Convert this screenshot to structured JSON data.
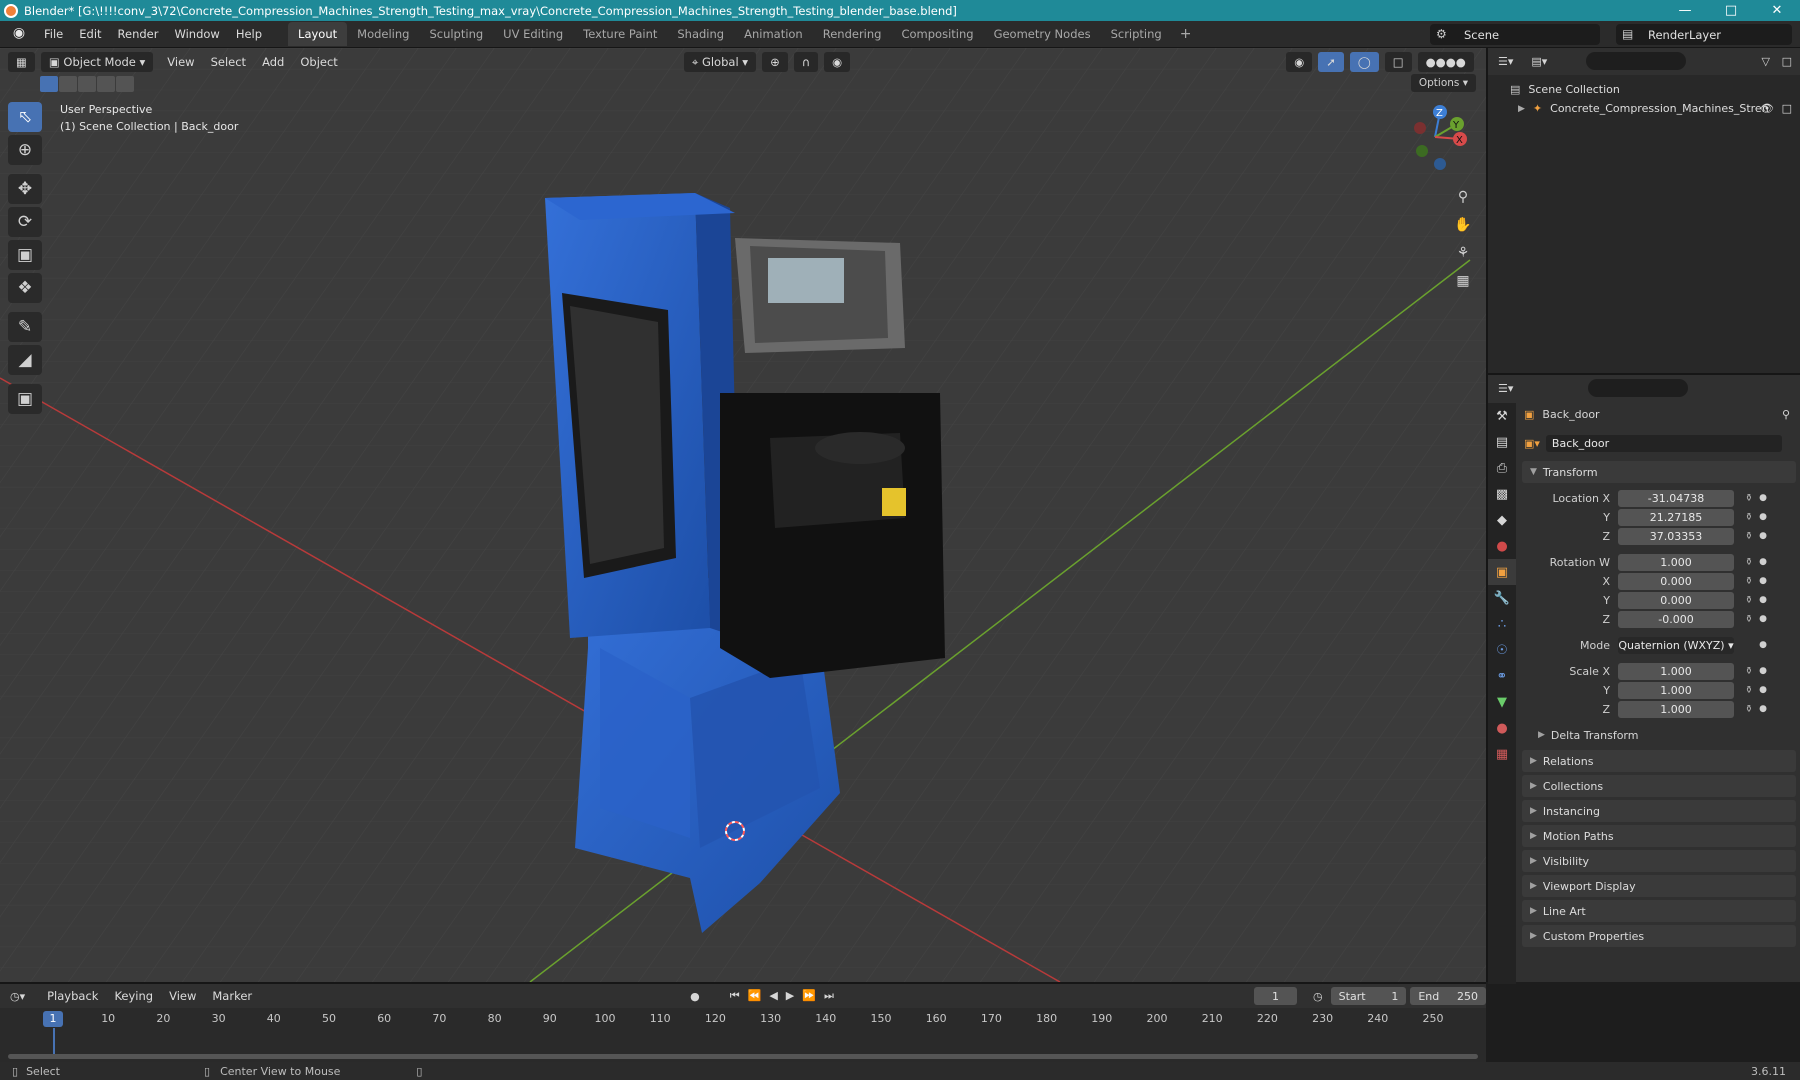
{
  "window": {
    "title": "Blender* [G:\\!!!!conv_3\\72\\Concrete_Compression_Machines_Strength_Testing_max_vray\\Concrete_Compression_Machines_Strength_Testing_blender_base.blend]"
  },
  "menu": [
    "File",
    "Edit",
    "Render",
    "Window",
    "Help"
  ],
  "workspaces": [
    "Layout",
    "Modeling",
    "Sculpting",
    "UV Editing",
    "Texture Paint",
    "Shading",
    "Animation",
    "Rendering",
    "Compositing",
    "Geometry Nodes",
    "Scripting"
  ],
  "active_workspace": "Layout",
  "scene": {
    "name": "Scene",
    "render_layer": "RenderLayer"
  },
  "viewport": {
    "mode": "Object Mode",
    "menus": [
      "View",
      "Select",
      "Add",
      "Object"
    ],
    "orientation": "Global",
    "options": "Options",
    "perspective_label": "User Perspective",
    "collection_label": "(1) Scene Collection | Back_door",
    "gizmo_axes": {
      "x": "X",
      "y": "Y",
      "z": "Z"
    }
  },
  "outliner": {
    "root": "Scene Collection",
    "items": [
      {
        "label": "Concrete_Compression_Machines_Stren"
      }
    ]
  },
  "properties": {
    "object_name": "Back_door",
    "datablock_name": "Back_door",
    "transform_title": "Transform",
    "location": {
      "label": "Location X",
      "x": "-31.04738",
      "y": "21.27185",
      "z": "37.03353"
    },
    "rotation": {
      "label": "Rotation W",
      "w": "1.000",
      "x": "0.000",
      "y": "0.000",
      "z": "-0.000"
    },
    "mode_label": "Mode",
    "mode": "Quaternion (WXYZ)",
    "scale": {
      "label": "Scale X",
      "x": "1.000",
      "y": "1.000",
      "z": "1.000"
    },
    "axis_labels": {
      "x": "X",
      "y": "Y",
      "z": "Z"
    },
    "delta_transform": "Delta Transform",
    "panels": [
      "Relations",
      "Collections",
      "Instancing",
      "Motion Paths",
      "Visibility",
      "Viewport Display",
      "Line Art",
      "Custom Properties"
    ]
  },
  "timeline": {
    "menus": [
      "Playback",
      "Keying",
      "View",
      "Marker"
    ],
    "current_frame": "1",
    "start_label": "Start",
    "start": "1",
    "end_label": "End",
    "end": "250",
    "ruler": [
      "10",
      "20",
      "30",
      "40",
      "50",
      "60",
      "70",
      "80",
      "90",
      "100",
      "110",
      "120",
      "130",
      "140",
      "150",
      "160",
      "170",
      "180",
      "190",
      "200",
      "210",
      "220",
      "230",
      "240",
      "250"
    ]
  },
  "status": {
    "left": "Select",
    "middle": "Center View to Mouse",
    "version": "3.6.11"
  },
  "colors": {
    "accent": "#4772b3",
    "titlebar": "#1f8a98",
    "machine_blue": "#2a5fc7",
    "x_axis": "#b83a3a",
    "y_axis": "#6aa12e"
  }
}
